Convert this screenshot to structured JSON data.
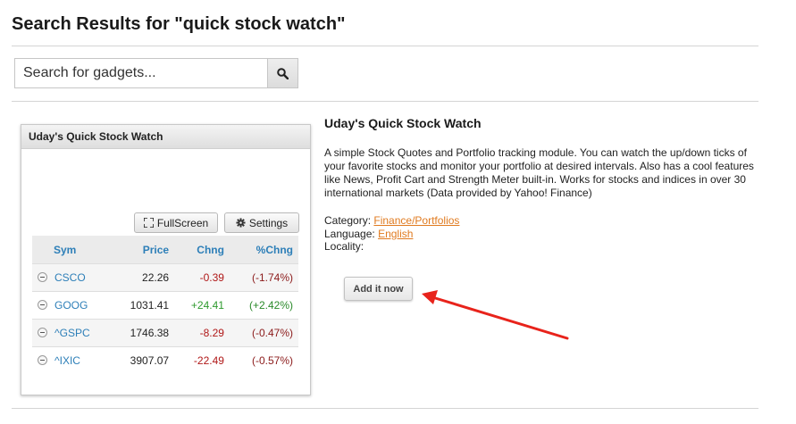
{
  "page_title": "Search Results for \"quick stock watch\"",
  "search": {
    "placeholder": "Search for gadgets...",
    "button_icon": "search-icon"
  },
  "gadget_preview": {
    "header": "Uday's Quick Stock Watch",
    "fullscreen_label": "FullScreen",
    "settings_label": "Settings",
    "columns": [
      "Sym",
      "Price",
      "Chng",
      "%Chng"
    ],
    "rows": [
      {
        "sym": "CSCO",
        "price": "22.26",
        "chng": "-0.39",
        "pct": "(-1.74%)"
      },
      {
        "sym": "GOOG",
        "price": "1031.41",
        "chng": "+24.41",
        "pct": "(+2.42%)"
      },
      {
        "sym": "^GSPC",
        "price": "1746.38",
        "chng": "-8.29",
        "pct": "(-0.47%)"
      },
      {
        "sym": "^IXIC",
        "price": "3907.07",
        "chng": "-22.49",
        "pct": "(-0.57%)"
      }
    ]
  },
  "detail": {
    "title": "Uday's Quick Stock Watch",
    "description": "A simple Stock Quotes and Portfolio tracking module. You can watch the up/down ticks of your favorite stocks and monitor your portfolio at desired intervals. Also has a cool features like News, Profit Cart and Strength Meter built-in. Works for stocks and indices in over 30 international markets (Data provided by Yahoo! Finance)",
    "category_label": "Category:",
    "category_value": "Finance/Portfolios",
    "language_label": "Language:",
    "language_value": "English",
    "locality_label": "Locality:",
    "add_button": "Add it now"
  },
  "colors": {
    "link": "#2d7fb8",
    "meta_link": "#e07a1f",
    "arrow": "#e8231b",
    "positive": "#2f9a2f",
    "negative": "#b01818"
  }
}
